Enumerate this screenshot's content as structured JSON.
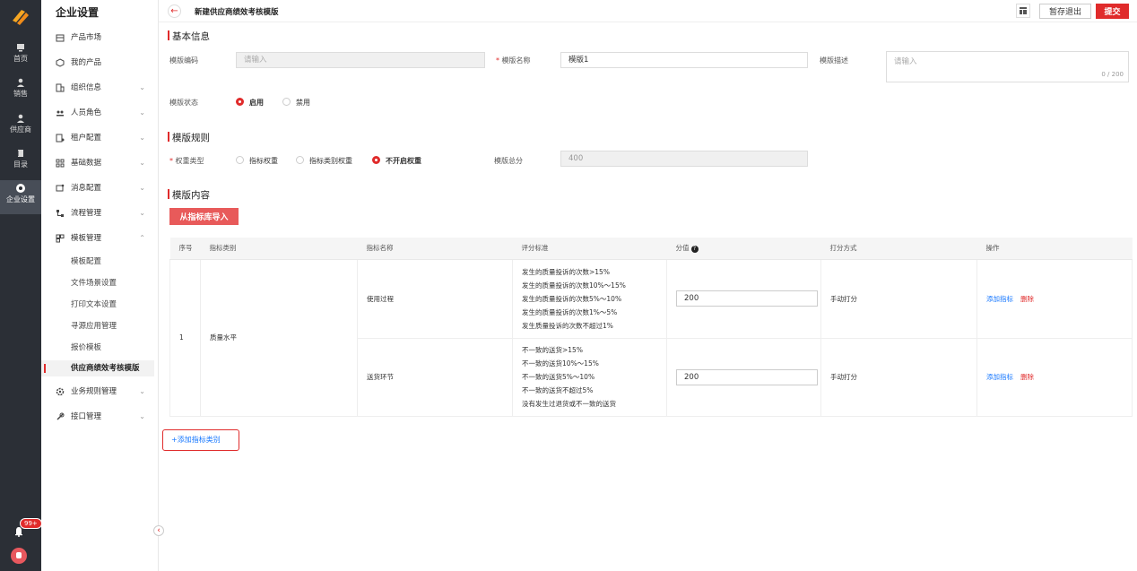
{
  "rail": {
    "items": [
      "首页",
      "销售",
      "供应商",
      "目录",
      "企业设置"
    ],
    "badge": "99+"
  },
  "menu": {
    "title": "企业设置",
    "items": [
      {
        "label": "产品市场",
        "icon": "storefront-icon",
        "chev": ""
      },
      {
        "label": "我的产品",
        "icon": "cube-icon",
        "chev": ""
      },
      {
        "label": "组织信息",
        "icon": "org-icon",
        "chev": "⌄"
      },
      {
        "label": "人员角色",
        "icon": "users-icon",
        "chev": "⌄"
      },
      {
        "label": "租户配置",
        "icon": "tenant-icon",
        "chev": "⌄"
      },
      {
        "label": "基础数据",
        "icon": "data-icon",
        "chev": "⌄"
      },
      {
        "label": "消息配置",
        "icon": "message-icon",
        "chev": "⌄"
      },
      {
        "label": "流程管理",
        "icon": "flow-icon",
        "chev": "⌄"
      },
      {
        "label": "模板管理",
        "icon": "template-icon",
        "chev": "⌃"
      }
    ],
    "subitems": [
      "模板配置",
      "文件场景设置",
      "打印文本设置",
      "寻源应用管理",
      "报价模板",
      "供应商绩效考核模版"
    ],
    "after": [
      {
        "label": "业务规则管理",
        "icon": "rules-icon",
        "chev": "⌄"
      },
      {
        "label": "接口管理",
        "icon": "api-icon",
        "chev": "⌄"
      }
    ]
  },
  "header": {
    "title": "新建供应商绩效考核模版",
    "save": "暂存退出",
    "submit": "提交"
  },
  "basic": {
    "section": "基本信息",
    "code_label": "模版编码",
    "code_placeholder": "请输入",
    "name_label": "模版名称",
    "name_value": "模版1",
    "desc_label": "模版描述",
    "desc_placeholder": "请输入",
    "desc_count": "0 / 200",
    "status_label": "模版状态",
    "status_on": "启用",
    "status_off": "禁用"
  },
  "rules": {
    "section": "模版规则",
    "weight_label": "权重类型",
    "opt1": "指标权重",
    "opt2": "指标类别权重",
    "opt3": "不开启权重",
    "total_label": "模版总分",
    "total_value": "400"
  },
  "content": {
    "section": "模版内容",
    "import": "从指标库导入",
    "headers": [
      "序号",
      "指标类别",
      "指标名称",
      "评分标准",
      "分值",
      "打分方式",
      "操作"
    ],
    "row_no": "1",
    "category": "质量水平",
    "rows": [
      {
        "name": "使用过程",
        "criteria": [
          "发生的质量投诉的次数>15%",
          "发生的质量投诉的次数10%～15%",
          "发生的质量投诉的次数5%～10%",
          "发生的质量投诉的次数1%～5%",
          "发生质量投诉的次数不超过1%"
        ],
        "score": "200",
        "method": "手动打分"
      },
      {
        "name": "送货环节",
        "criteria": [
          "不一致的送货>15%",
          "不一致的送货10%～15%",
          "不一致的送货5%～10%",
          "不一致的送货不超过5%",
          "没有发生过退货或不一致的送货"
        ],
        "score": "200",
        "method": "手动打分"
      }
    ],
    "add_metric": "添加指标",
    "delete": "删除",
    "add_category": "+添加指标类别"
  }
}
